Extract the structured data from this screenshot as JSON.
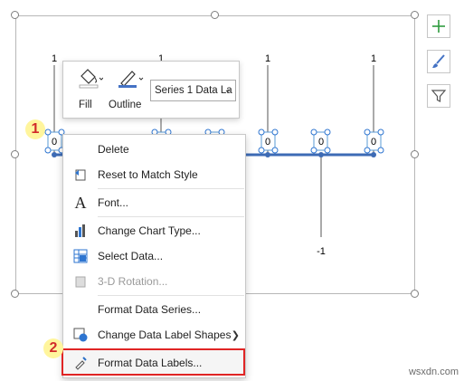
{
  "chart_data": {
    "type": "line",
    "data_labels_above": [
      "1",
      "1",
      "1",
      "1"
    ],
    "data_labels_zero": [
      "0",
      "0",
      "0",
      "0",
      "0",
      "0"
    ],
    "data_label_minus": "-1",
    "colors": {
      "series": "#3d6bb5",
      "handle_blue": "#2e75d0"
    }
  },
  "mini_toolbar": {
    "fill_label": "Fill",
    "outline_label": "Outline",
    "series_select_value": "Series 1 Data La"
  },
  "context_menu": {
    "items": [
      {
        "label": "Delete",
        "icon": "delete-icon",
        "disabled": false
      },
      {
        "label": "Reset to Match Style",
        "icon": "reset-style-icon",
        "disabled": false
      },
      {
        "label": "Font...",
        "icon": "font-icon",
        "disabled": false
      },
      {
        "label": "Change Chart Type...",
        "icon": "chart-type-icon",
        "disabled": false
      },
      {
        "label": "Select Data...",
        "icon": "select-data-icon",
        "disabled": false
      },
      {
        "label": "3-D Rotation...",
        "icon": "3d-rotation-icon",
        "disabled": true
      },
      {
        "label": "Format Data Series...",
        "icon": "",
        "disabled": false
      },
      {
        "label": "Change Data Label Shapes",
        "icon": "label-shapes-icon",
        "disabled": false
      },
      {
        "label": "Format Data Labels...",
        "icon": "format-labels-icon",
        "disabled": false
      }
    ]
  },
  "callouts": {
    "one": "1",
    "two": "2"
  },
  "watermark": "wsxdn.com",
  "colors": {
    "highlight": "#e02525",
    "callout_bg": "#fff59d",
    "callout_text": "#d12a2a",
    "plus_green": "#2e9b3e"
  }
}
